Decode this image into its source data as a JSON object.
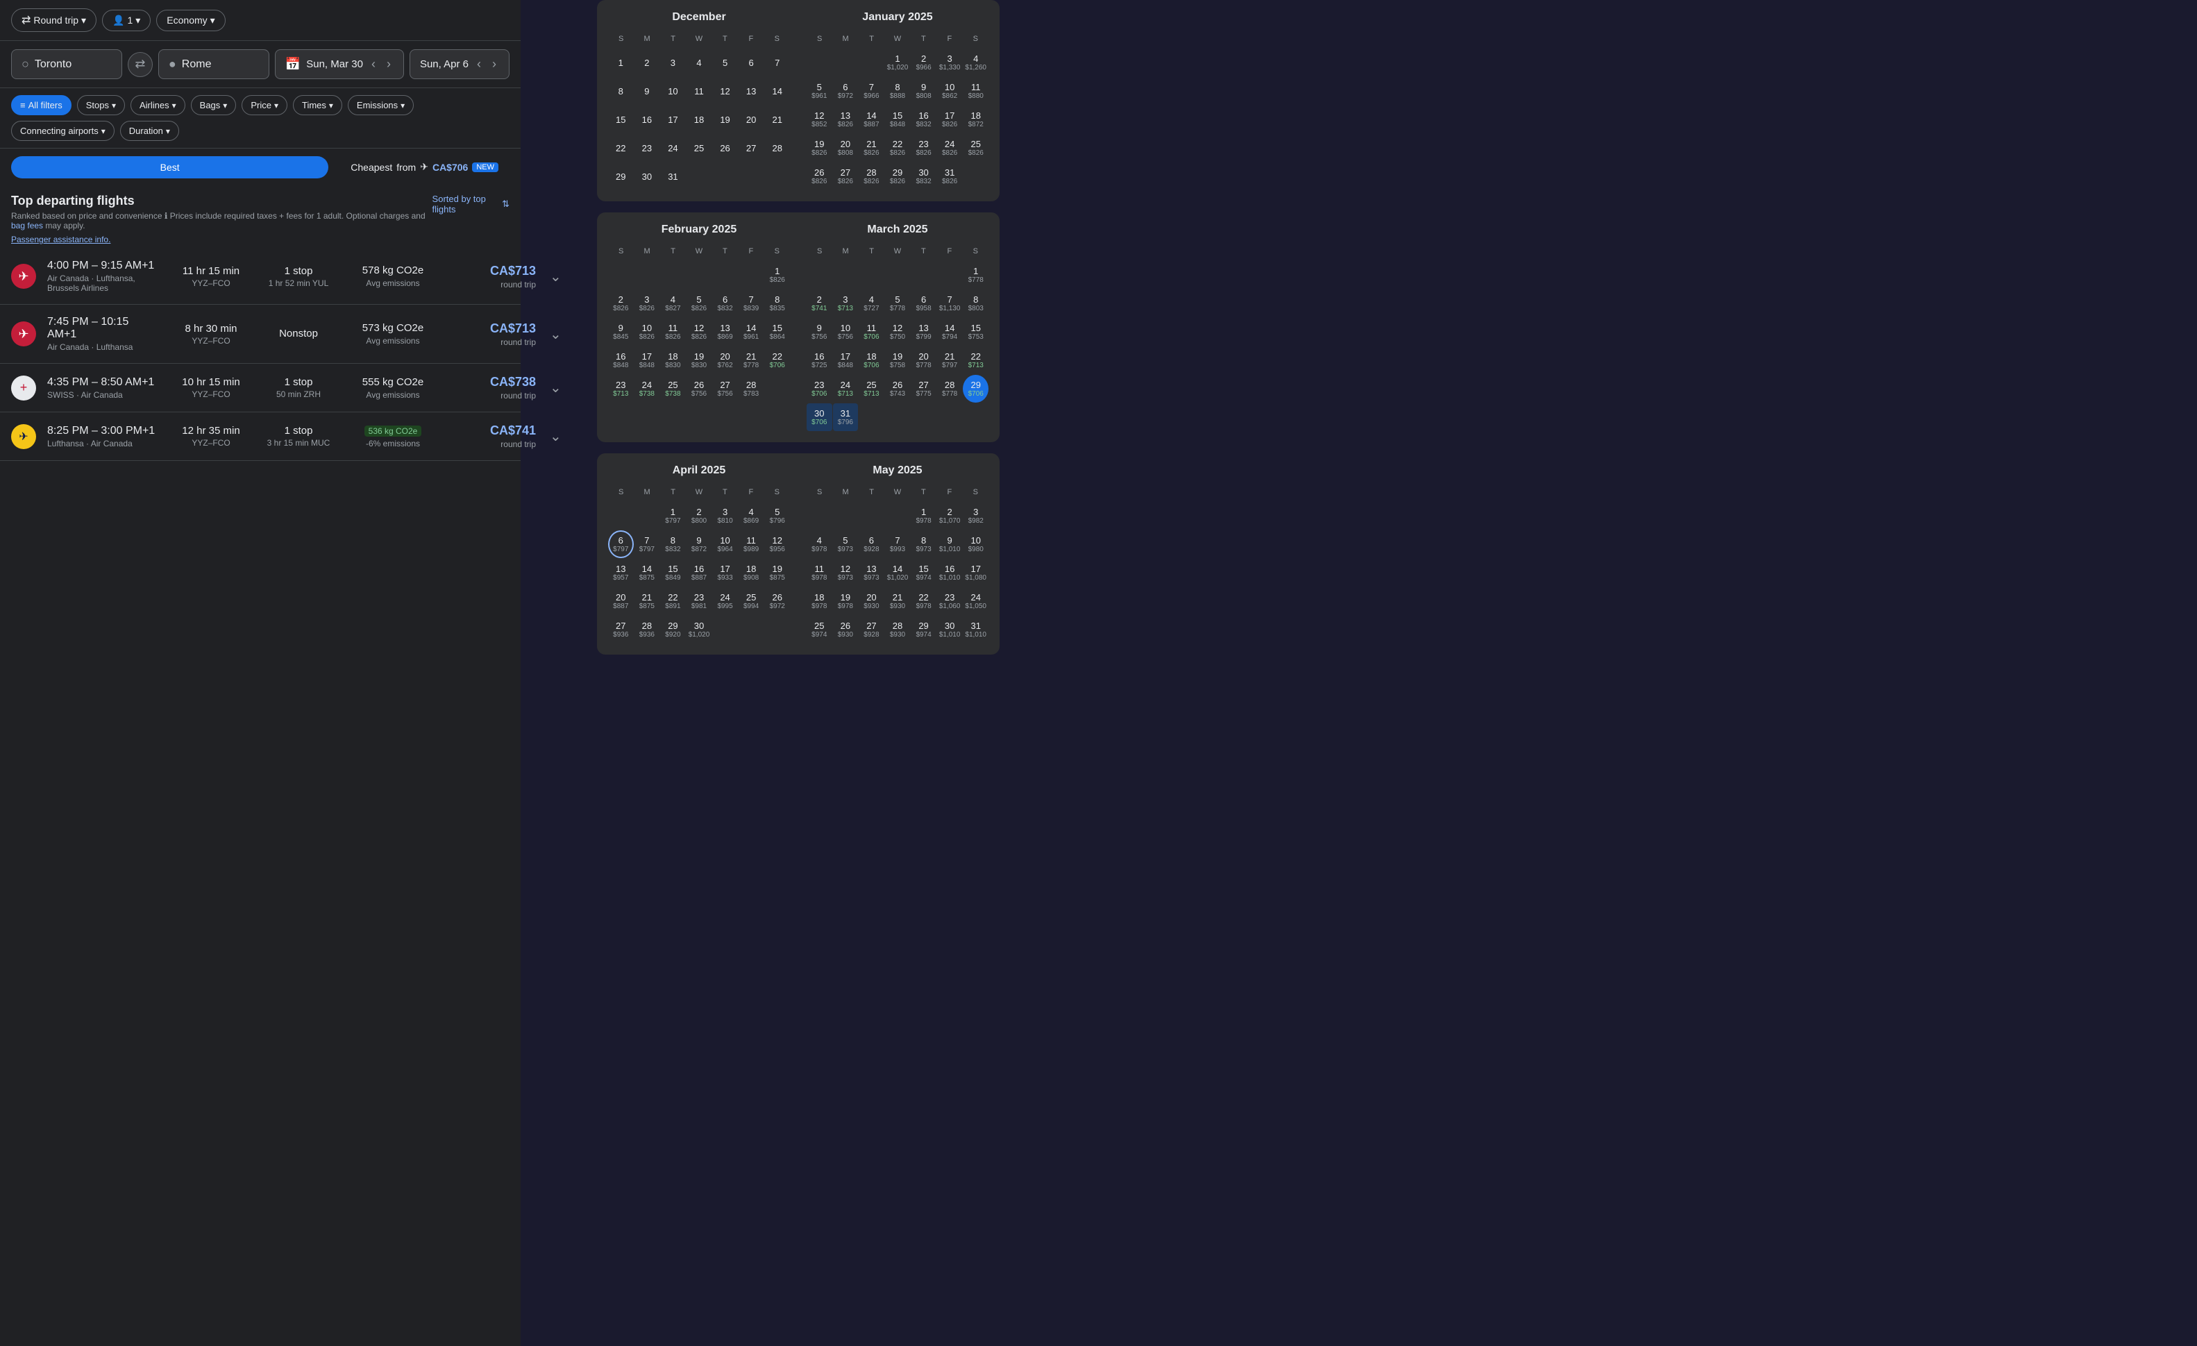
{
  "tripType": "Round trip",
  "passengers": "1",
  "class": "Economy",
  "origin": "Toronto",
  "destination": "Rome",
  "dateDepart": "Sun, Mar 30",
  "dateReturn": "Sun, Apr 6",
  "filters": {
    "allFilters": "All filters",
    "stops": "Stops",
    "airlines": "Airlines",
    "bags": "Bags",
    "price": "Price",
    "times": "Times",
    "emissions": "Emissions",
    "connectingAirports": "Connecting airports",
    "duration": "Duration"
  },
  "sortBest": "Best",
  "sortCheapest": "Cheapest",
  "cheapestFrom": "from",
  "cheapestPrice": "CA$706",
  "newLabel": "NEW",
  "resultsTitle": "Top departing flights",
  "resultsSubtitle": "Ranked based on price and convenience",
  "pricingNote": "Prices include required taxes + fees for 1 adult. Optional charges and",
  "bagFeesLink": "bag fees",
  "mayApply": "may apply.",
  "passengerLink": "Passenger assistance info.",
  "sortedBy": "Sorted by top flights",
  "flights": [
    {
      "times": "4:00 PM – 9:15 AM+1",
      "airlines": "Air Canada · Lufthansa, Brussels Airlines",
      "route": "YYZ–FCO",
      "duration": "11 hr 15 min",
      "stopDetail": "1 hr 52 min YUL",
      "stops": "1 stop",
      "emissions": "578 kg CO2e",
      "emissionsLabel": "Avg emissions",
      "price": "CA$713",
      "priceType": "round trip",
      "logoType": "air-canada"
    },
    {
      "times": "7:45 PM – 10:15 AM+1",
      "airlines": "Air Canada · Lufthansa",
      "route": "YYZ–FCO",
      "duration": "8 hr 30 min",
      "stops": "Nonstop",
      "stopDetail": "",
      "emissions": "573 kg CO2e",
      "emissionsLabel": "Avg emissions",
      "price": "CA$713",
      "priceType": "round trip",
      "logoType": "air-canada"
    },
    {
      "times": "4:35 PM – 8:50 AM+1",
      "airlines": "SWISS · Air Canada",
      "route": "YYZ–FCO",
      "duration": "10 hr 15 min",
      "stops": "1 stop",
      "stopDetail": "50 min ZRH",
      "emissions": "555 kg CO2e",
      "emissionsLabel": "Avg emissions",
      "price": "CA$738",
      "priceType": "round trip",
      "logoType": "swiss"
    },
    {
      "times": "8:25 PM – 3:00 PM+1",
      "airlines": "Lufthansa · Air Canada",
      "route": "YYZ–FCO",
      "duration": "12 hr 35 min",
      "stops": "1 stop",
      "stopDetail": "3 hr 15 min MUC",
      "emissions": "536 kg CO2e",
      "emissionsLabel": "-6% emissions",
      "emissionsLow": true,
      "price": "CA$741",
      "priceType": "round trip",
      "logoType": "lufthansa"
    }
  ],
  "calendars": [
    {
      "title": "December",
      "year": "",
      "days": [
        1,
        2,
        3,
        4,
        5,
        6,
        7,
        8,
        9,
        10,
        11,
        12,
        13,
        14,
        15,
        16,
        17,
        18,
        19,
        20,
        21,
        22,
        23,
        24,
        25,
        26,
        27,
        28,
        29,
        30,
        31
      ],
      "startDay": 0,
      "prices": [
        null,
        null,
        null,
        null,
        null,
        null,
        null,
        null,
        null,
        null,
        null,
        null,
        null,
        null,
        null,
        null,
        null,
        null,
        null,
        null,
        null,
        null,
        null,
        null,
        null,
        null,
        null,
        null,
        null,
        null,
        null
      ]
    },
    {
      "title": "January 2025",
      "days": [
        1,
        2,
        3,
        4,
        5,
        6,
        7,
        8,
        9,
        10,
        11,
        12,
        13,
        14,
        15,
        16,
        17,
        18,
        19,
        20,
        21,
        22,
        23,
        24,
        25,
        26,
        27,
        28,
        29,
        30,
        31
      ],
      "startDay": 3
    },
    {
      "title": "February 2025",
      "days": [
        1,
        2,
        3,
        4,
        5,
        6,
        7,
        8,
        9,
        10,
        11,
        12,
        13,
        14,
        15,
        16,
        17,
        18,
        19,
        20,
        21,
        22,
        23,
        24,
        25,
        26,
        27,
        28
      ],
      "startDay": 6
    },
    {
      "title": "March 2025",
      "days": [
        1,
        2,
        3,
        4,
        5,
        6,
        7,
        8,
        9,
        10,
        11,
        12,
        13,
        14,
        15,
        16,
        17,
        18,
        19,
        20,
        21,
        22,
        23,
        24,
        25,
        26,
        27,
        28,
        29,
        30,
        31
      ],
      "startDay": 6
    },
    {
      "title": "April 2025",
      "days": [
        1,
        2,
        3,
        4,
        5,
        6,
        7,
        8,
        9,
        10,
        11,
        12,
        13,
        14,
        15,
        16,
        17,
        18,
        19,
        20,
        21,
        22,
        23,
        24,
        25,
        26,
        27,
        28,
        29,
        30
      ],
      "startDay": 2
    },
    {
      "title": "May 2025",
      "days": [
        1,
        2,
        3,
        4,
        5,
        6,
        7,
        8,
        9,
        10,
        11,
        12,
        13,
        14,
        15,
        16,
        17,
        18,
        19,
        20,
        21,
        22,
        23,
        24,
        25,
        26,
        27,
        28,
        29,
        30,
        31
      ],
      "startDay": 4
    }
  ]
}
